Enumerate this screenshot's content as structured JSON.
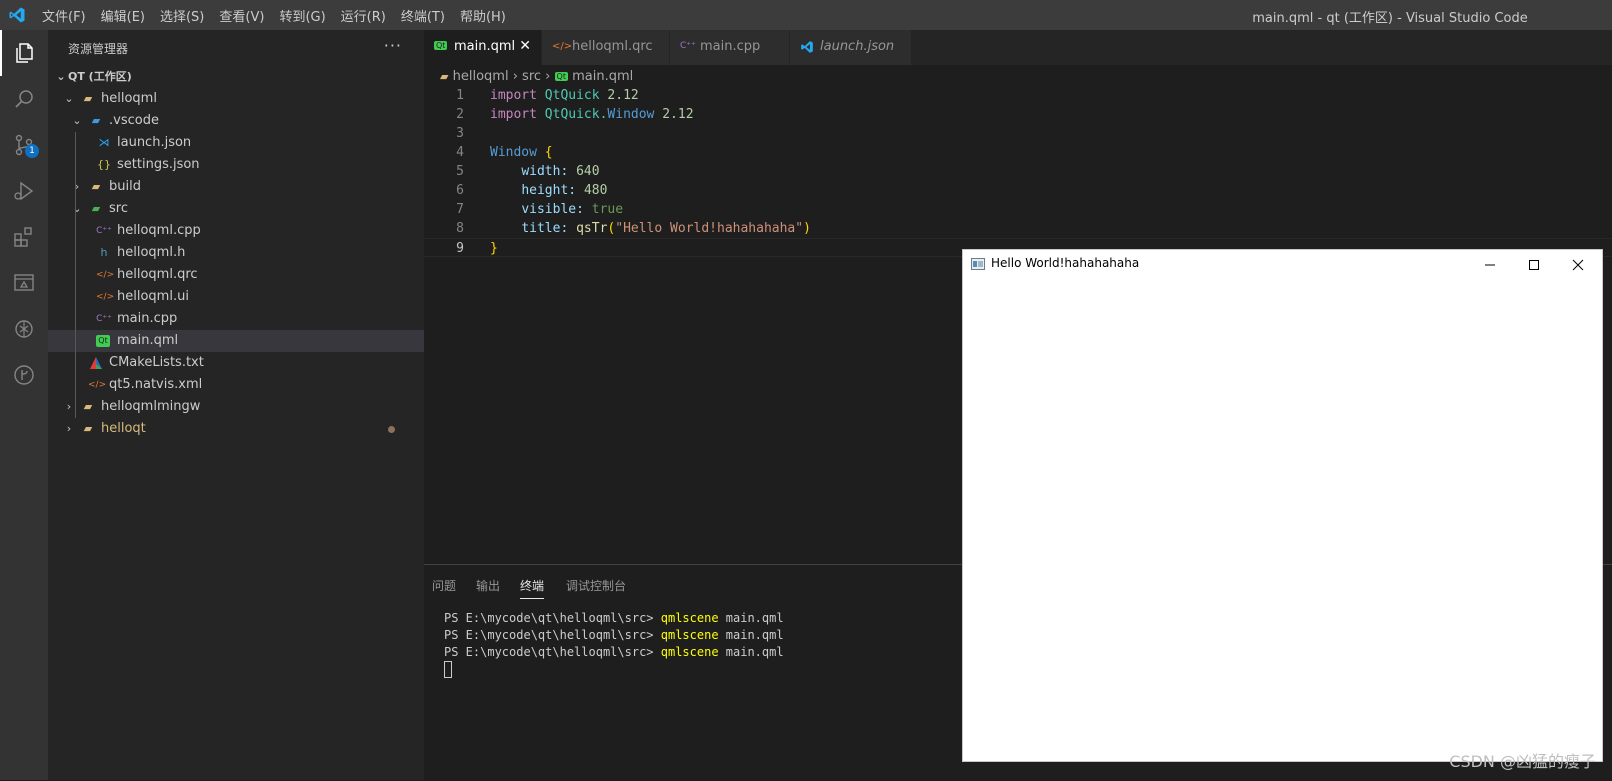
{
  "titlebar": {
    "menu": [
      "文件(F)",
      "编辑(E)",
      "选择(S)",
      "查看(V)",
      "转到(G)",
      "运行(R)",
      "终端(T)",
      "帮助(H)"
    ],
    "window_title": "main.qml - qt (工作区) - Visual Studio Code"
  },
  "activity_bar": {
    "items": [
      "explorer-icon",
      "search-icon",
      "source-control-icon",
      "run-debug-icon",
      "extensions-icon",
      "remote-explorer-icon",
      "chatgpt-icon",
      "gitlens-icon"
    ],
    "source_control_badge": "1"
  },
  "sidebar": {
    "title": "资源管理器",
    "more": "···",
    "workspace": "QT (工作区)",
    "tree": [
      {
        "label": "helloqml",
        "icon": "folder"
      },
      {
        "label": ".vscode",
        "icon": "vscode-folder"
      },
      {
        "label": "launch.json",
        "icon": "vscode-file"
      },
      {
        "label": "settings.json",
        "icon": "json"
      },
      {
        "label": "build",
        "icon": "folder"
      },
      {
        "label": "src",
        "icon": "src-folder"
      },
      {
        "label": "helloqml.cpp",
        "icon": "cpp"
      },
      {
        "label": "helloqml.h",
        "icon": "header"
      },
      {
        "label": "helloqml.qrc",
        "icon": "xml"
      },
      {
        "label": "helloqml.ui",
        "icon": "xml"
      },
      {
        "label": "main.cpp",
        "icon": "cpp"
      },
      {
        "label": "main.qml",
        "icon": "qt"
      },
      {
        "label": "CMakeLists.txt",
        "icon": "cmake"
      },
      {
        "label": "qt5.natvis.xml",
        "icon": "xml"
      },
      {
        "label": "helloqmlmingw",
        "icon": "folder"
      },
      {
        "label": "helloqt",
        "icon": "folder"
      }
    ]
  },
  "tabs": [
    {
      "label": "main.qml",
      "icon": "Qt",
      "close": "✕"
    },
    {
      "label": "helloqml.qrc",
      "icon": "</>"
    },
    {
      "label": "main.cpp",
      "icon": "C++"
    },
    {
      "label": "launch.json",
      "icon": "vscode"
    }
  ],
  "breadcrumb": {
    "parts": [
      "helloqml",
      "src",
      "main.qml"
    ],
    "sep": "›",
    "qt_badge": "Qt"
  },
  "code": {
    "line_numbers": [
      "1",
      "2",
      "3",
      "4",
      "5",
      "6",
      "7",
      "8",
      "9"
    ],
    "l1": {
      "kw": "import",
      "mod": "QtQuick",
      "ver": "2.12"
    },
    "l2": {
      "kw": "import",
      "mod": "QtQuick.",
      "mod2": "Window",
      "ver": "2.12"
    },
    "l4": {
      "type": "Window",
      "brace": "{"
    },
    "l5": {
      "prop": "width:",
      "val": "640"
    },
    "l6": {
      "prop": "height:",
      "val": "480"
    },
    "l7": {
      "prop": "visible:",
      "val": "true"
    },
    "l8": {
      "prop": "title:",
      "fn": "qsTr",
      "open": "(",
      "str": "\"Hello World!hahahahaha\"",
      "close": ")"
    },
    "l9": {
      "brace": "}"
    }
  },
  "panel": {
    "tabs": [
      "问题",
      "输出",
      "终端",
      "调试控制台"
    ],
    "terminal": {
      "prompt": "PS E:\\mycode\\qt\\helloqml\\src> ",
      "cmd": "qmlscene",
      "arg": " main.qml"
    }
  },
  "qt_window": {
    "title": "Hello World!hahahahaha",
    "minimize": "—",
    "maximize": "☐",
    "close": "✕"
  },
  "watermark": "CSDN @凶猛的瘦子"
}
